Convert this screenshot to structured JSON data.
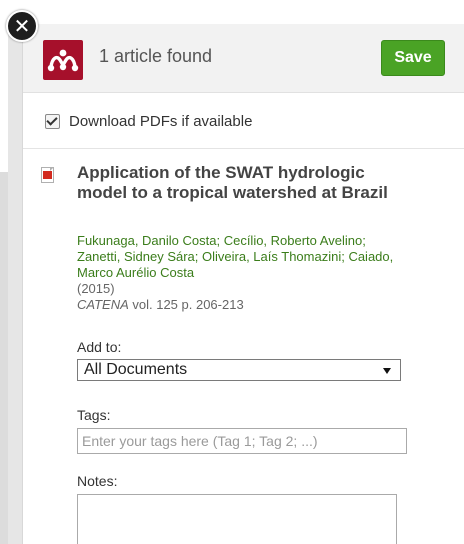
{
  "header": {
    "title": "1 article found",
    "save_label": "Save"
  },
  "options": {
    "download_pdfs_label": "Download PDFs if available",
    "download_pdfs_checked": true
  },
  "article": {
    "title": "Application of the SWAT hydrologic model to a tropical watershed at Brazil",
    "authors": "Fukunaga, Danilo Costa;  Cecílio, Roberto Avelino;  Zanetti, Sidney Sára;  Oliveira, Laís Thomazini;  Caiado, Marco Aurélio Costa",
    "year": "(2015)",
    "journal": "CATENA",
    "volume_pages": " vol. 125 p. 206-213"
  },
  "form": {
    "add_to_label": "Add to:",
    "add_to_selected": "All Documents",
    "tags_label": "Tags:",
    "tags_placeholder": "Enter your tags here (Tag 1; Tag 2; ...)",
    "tags_value": "",
    "notes_label": "Notes:",
    "notes_value": ""
  },
  "icons": {
    "close": "close-icon",
    "logo": "mendeley-logo-icon",
    "pdf": "pdf-file-icon",
    "dropdown": "chevron-down-icon"
  },
  "colors": {
    "brand": "#a6102b",
    "save_button": "#4aa325",
    "authors_text": "#3b7d1b"
  }
}
